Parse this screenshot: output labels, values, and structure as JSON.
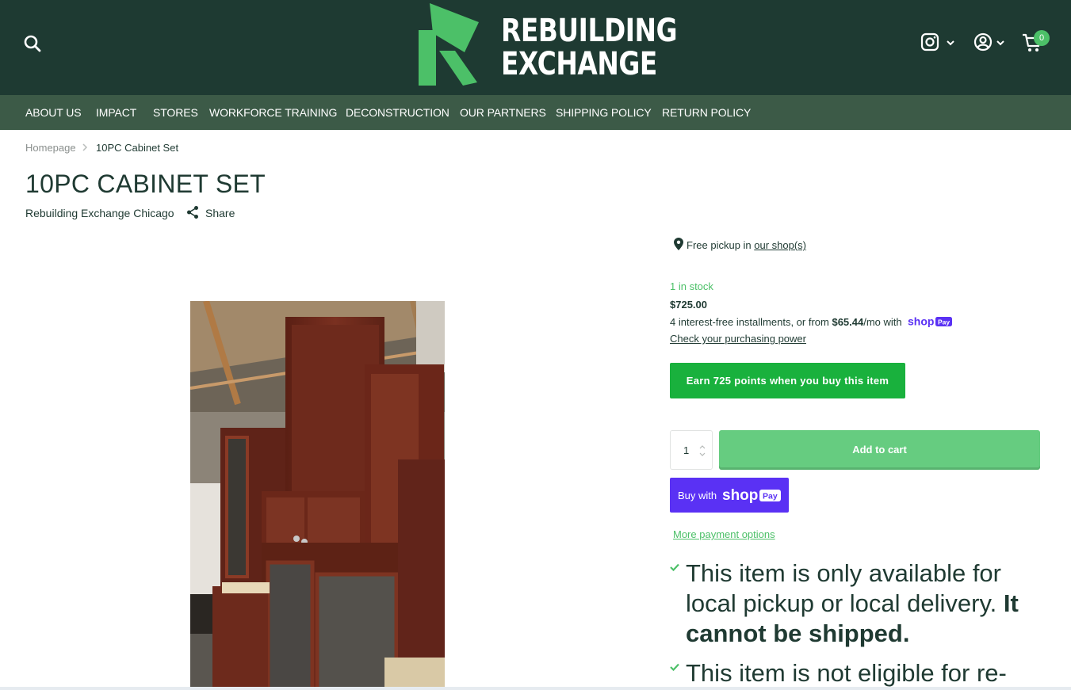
{
  "brand": {
    "name_line1": "REBUILDING",
    "name_line2": "EXCHANGE",
    "logo_color": "#4cc068",
    "header_bg": "#1e3a32",
    "nav_bg": "#3c5a47",
    "accent": "#4cc068"
  },
  "header": {
    "cart_count": "0",
    "icons": [
      "search-icon",
      "instagram-icon",
      "account-icon",
      "cart-icon"
    ]
  },
  "nav": {
    "items": [
      "ABOUT US",
      "IMPACT",
      "STORES",
      "WORKFORCE TRAINING",
      "DECONSTRUCTION",
      "OUR PARTNERS",
      "SHIPPING POLICY",
      "RETURN POLICY"
    ]
  },
  "breadcrumb": {
    "home": "Homepage",
    "current": "10PC Cabinet Set"
  },
  "product": {
    "title": "10PC CABINET SET",
    "vendor": "Rebuilding Exchange Chicago",
    "share_label": "Share",
    "pickup_text": "Free pickup in ",
    "pickup_link": "our shop(s)",
    "stock": "1 in stock",
    "price": "$725.00",
    "installments_prefix": "4 interest-free installments, or from ",
    "installments_amount": "$65.44",
    "installments_suffix": "/mo with",
    "check_power": "Check your purchasing power",
    "earn_points": "Earn 725 points when you buy this item",
    "quantity": "1",
    "add_to_cart": "Add to cart",
    "buy_with": "Buy with",
    "shop_word": "shop",
    "pay_word": "Pay",
    "more_payment": "More payment options",
    "note1_text": "This item is only available for local pickup or local delivery. ",
    "note1_bold": "It cannot be shipped.",
    "note2_text": "This item is not eligible for re-"
  },
  "colors": {
    "shoppay": "#5a31f4",
    "earn_green": "#19b13d",
    "add_cart_green": "#66cc80"
  }
}
